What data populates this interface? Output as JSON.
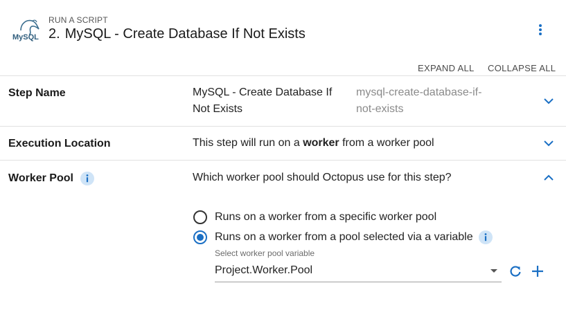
{
  "header": {
    "logo_text": "MySQL",
    "step_kind": "RUN A SCRIPT",
    "step_number": "2.",
    "step_title": "MySQL - Create Database If Not Exists",
    "menu_icon": "more-vertical-icon"
  },
  "toolbar": {
    "expand_all": "EXPAND ALL",
    "collapse_all": "COLLAPSE ALL"
  },
  "sections": {
    "step_name": {
      "label": "Step Name",
      "value_line1": "MySQL - Create Database If",
      "value_line2": "Not Exists",
      "slug_line1": "mysql-create-database-if-",
      "slug_line2": "not-exists"
    },
    "execution_location": {
      "label": "Execution Location",
      "text_before": "This step will run on a ",
      "text_bold": "worker",
      "text_after": " from a worker pool"
    },
    "worker_pool": {
      "label": "Worker Pool",
      "question": "Which worker pool should Octopus use for this step?",
      "options": [
        {
          "label": "Runs on a worker from a specific worker pool",
          "selected": false
        },
        {
          "label": "Runs on a worker from a pool selected via a variable",
          "selected": true
        }
      ],
      "variable_field_label": "Select worker pool variable",
      "variable_value": "Project.Worker.Pool"
    }
  },
  "colors": {
    "accent": "#1a6fc4",
    "info_badge_bg": "#cfe4f7",
    "divider": "#e0e0e0"
  }
}
